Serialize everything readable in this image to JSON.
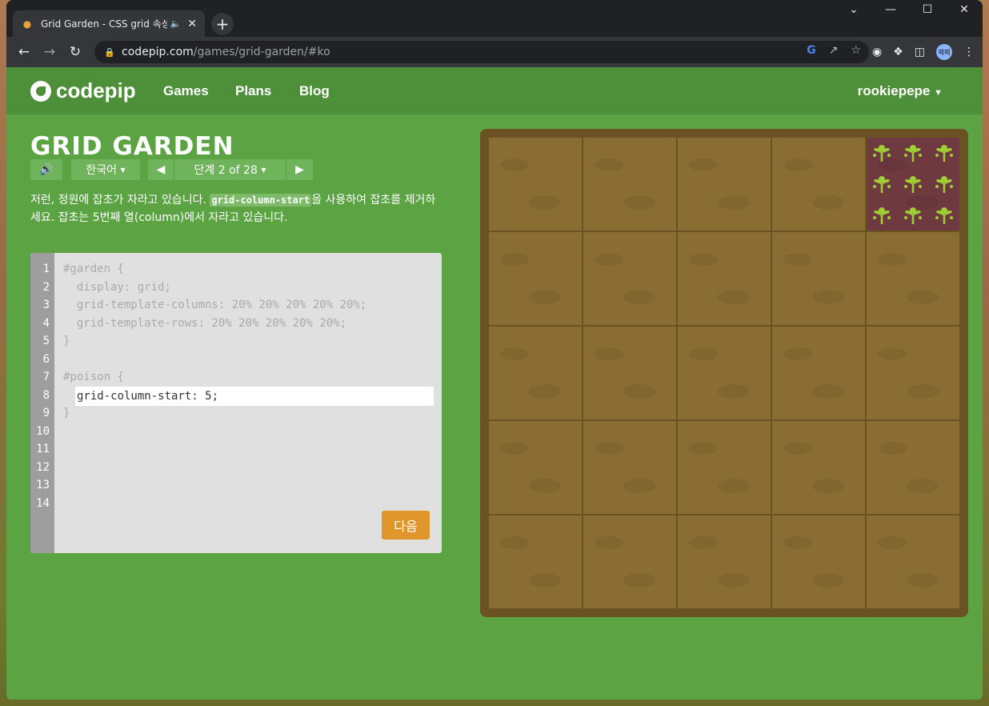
{
  "browser": {
    "tab_title": "Grid Garden - CSS grid 속성",
    "url_host": "codepip.com",
    "url_path": "/games/grid-garden/#ko",
    "profile": "폐폐"
  },
  "site": {
    "logo": "codepip",
    "nav": [
      "Games",
      "Plans",
      "Blog"
    ],
    "user": "rookiepepe"
  },
  "game": {
    "title": "GRID GARDEN",
    "language": "한국어",
    "level_label": "단계 2 of 28",
    "instructions_before": "저런, 정원에 잡초가 자라고 있습니다. ",
    "instructions_code": "grid-column-start",
    "instructions_after": "을 사용하여 잡초를 제거하세요. 잡초는 5번째 열(column)에서 자라고 있습니다.",
    "next_button": "다음"
  },
  "editor": {
    "line_numbers": [
      "1",
      "2",
      "3",
      "4",
      "5",
      "6",
      "7",
      "8",
      "9",
      "10",
      "11",
      "12",
      "13",
      "14"
    ],
    "lines": [
      "#garden {",
      "  display: grid;",
      "  grid-template-columns: 20% 20% 20% 20% 20%;",
      "  grid-template-rows: 20% 20% 20% 20% 20%;",
      "}",
      "",
      "#poison {",
      "",
      "}"
    ],
    "input_value": "grid-column-start: 5;"
  },
  "garden": {
    "rows": 5,
    "columns": 5,
    "weed_cell": {
      "row": 1,
      "column": 5
    },
    "colors": {
      "soil": "#8a6d32",
      "border": "#6b5222",
      "weed_bg": "#6e3a40",
      "weed": "#9fce35"
    }
  }
}
